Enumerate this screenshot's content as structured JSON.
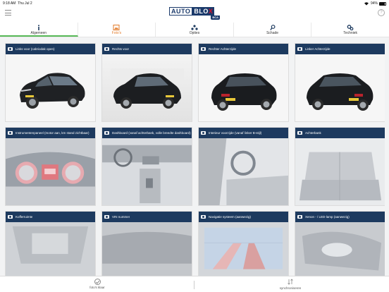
{
  "statusbar": {
    "time": "9:18 AM",
    "date": "Thu Jul 2",
    "battery": "94%",
    "wifi_icon": "wifi-icon"
  },
  "header": {
    "menu_icon": "hamburger-menu-icon",
    "logo_auto": "AUTO",
    "logo_blo": "BLO",
    "logo_x": "X",
    "logo_sub": "BCA",
    "help_icon": "help-icon",
    "help_symbol": "?"
  },
  "tabs": [
    {
      "label": "Algemeen",
      "icon": "info-icon",
      "symbol": "i"
    },
    {
      "label": "Foto's",
      "icon": "photo-icon"
    },
    {
      "label": "Opties",
      "icon": "options-icon"
    },
    {
      "label": "Schade",
      "icon": "search-icon"
    },
    {
      "label": "Techniek",
      "icon": "gears-icon"
    }
  ],
  "photos": [
    {
      "title": "Links voor (cabriodak open)"
    },
    {
      "title": "Rechts voor"
    },
    {
      "title": "Rechter Achterzijde"
    },
    {
      "title": "Linker Achterzijde"
    },
    {
      "title": "Instrumentenpaneel (motor aan, km stand zichtbaar)"
    },
    {
      "title": "Dashboard (vanaf achterbank, volle breedte dashboard)"
    },
    {
      "title": "Interieur voorzijde (vanaf linker B-stijl)"
    },
    {
      "title": "Achterbank"
    },
    {
      "title": "Kofferruimte"
    },
    {
      "title": "VIN nummer"
    },
    {
      "title": "Navigatie systeem (aanwezig)"
    },
    {
      "title": "Xenon - / LED-lamp (aanwezig)"
    }
  ],
  "bottombar": {
    "done_label": "foto's klaar",
    "sync_label": "synchroniseren"
  },
  "colors": {
    "card_header": "#1d3a5f",
    "active_tab": "#57b957",
    "brand_blue": "#1b3a6b",
    "brand_red": "#d0112b"
  }
}
